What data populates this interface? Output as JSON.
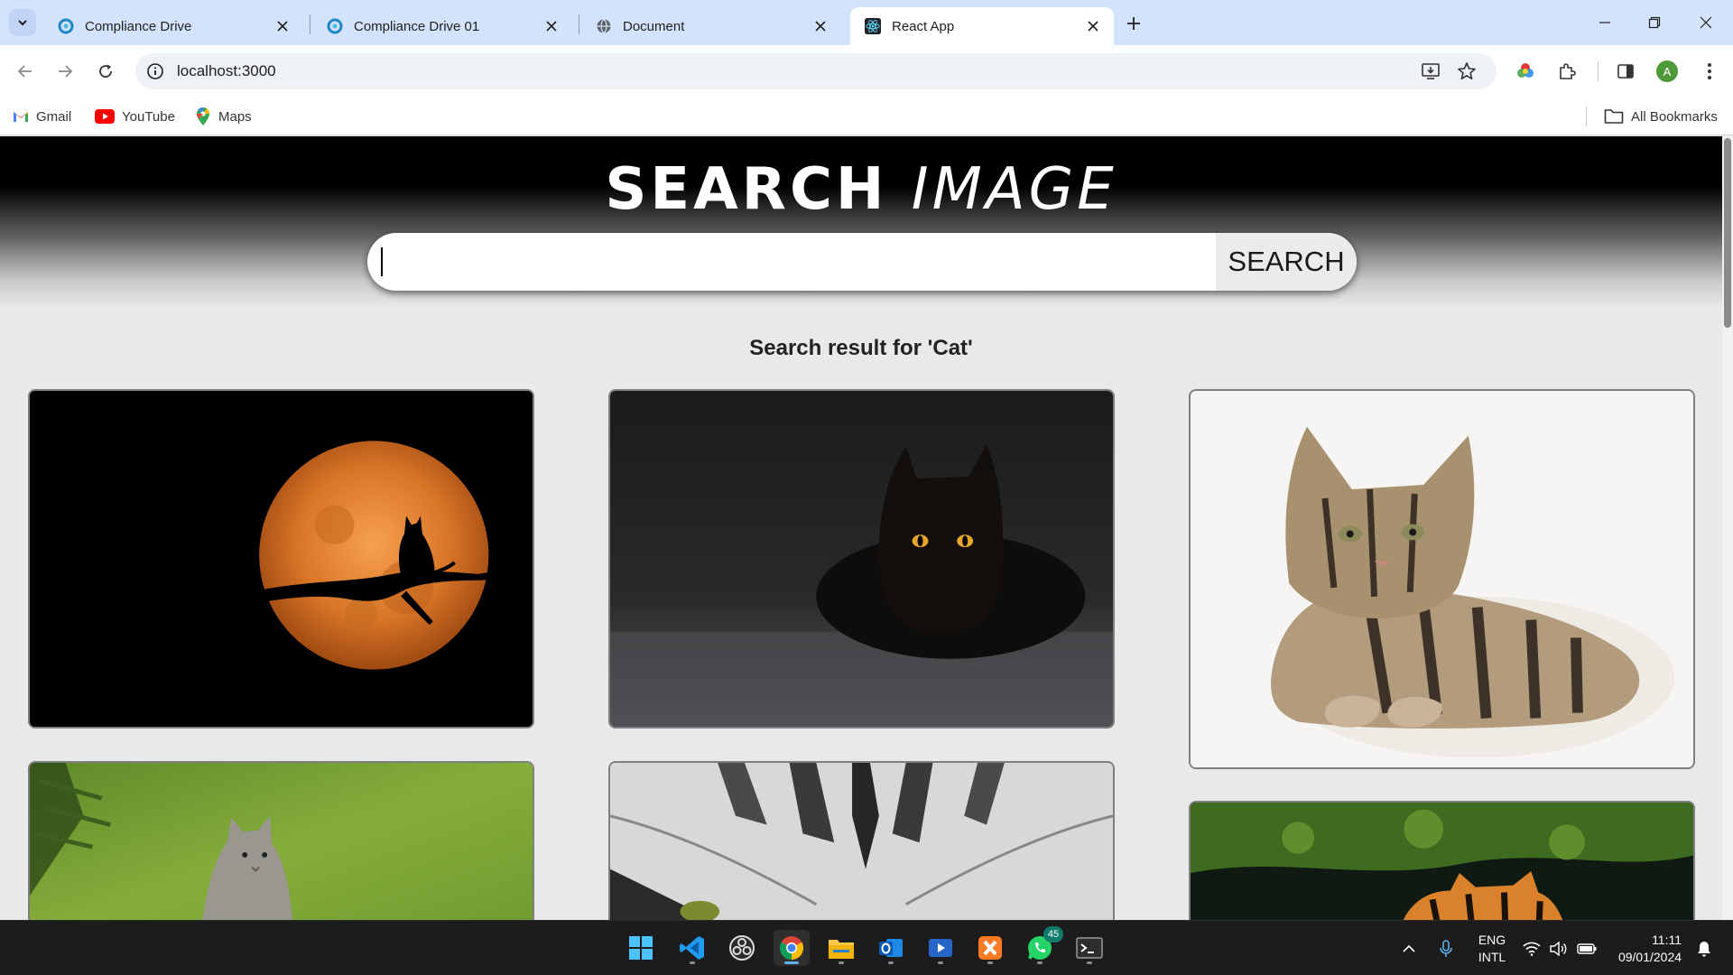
{
  "browser": {
    "tabs": [
      {
        "title": "Compliance Drive",
        "icon": "compliance-drive-icon",
        "active": false
      },
      {
        "title": "Compliance Drive 01",
        "icon": "compliance-drive-icon",
        "active": false
      },
      {
        "title": "Document",
        "icon": "globe-icon",
        "active": false
      },
      {
        "title": "React App",
        "icon": "react-icon",
        "active": true
      }
    ],
    "url": "localhost:3000",
    "bookmarks": [
      {
        "label": "Gmail",
        "icon": "gmail-icon"
      },
      {
        "label": "YouTube",
        "icon": "youtube-icon"
      },
      {
        "label": "Maps",
        "icon": "maps-icon"
      }
    ],
    "all_bookmarks_label": "All Bookmarks",
    "profile_initial": "A"
  },
  "app": {
    "title_word1": "SEARCH",
    "title_word2": "IMAGE",
    "search_value": "",
    "search_button": "SEARCH",
    "result_heading": "Search result for 'Cat'",
    "results": [
      {
        "name": "cat silhouette on branch against orange full moon"
      },
      {
        "name": "black long-haired cat crouching in dark"
      },
      {
        "name": "tabby kitten lying on white background"
      },
      {
        "name": "grey kitten looking up among green pine branches"
      },
      {
        "name": "close-up of grey striped cat fur and eye"
      },
      {
        "name": "tiger swimming in green algae water"
      }
    ]
  },
  "taskbar": {
    "apps": [
      "windows-start-icon",
      "vscode-icon",
      "obs-icon",
      "chrome-icon",
      "file-explorer-icon",
      "outlook-icon",
      "media-player-icon",
      "xampp-icon",
      "whatsapp-icon",
      "terminal-icon"
    ],
    "whatsapp_badge": "45",
    "language_line1": "ENG",
    "language_line2": "INTL",
    "time": "11:11",
    "date": "09/01/2024"
  },
  "colors": {
    "tabbar_bg": "#d3e3fd",
    "page_bg": "#e9e9e9",
    "hero_top": "#000000",
    "taskbar_bg": "#1c1c1c"
  }
}
